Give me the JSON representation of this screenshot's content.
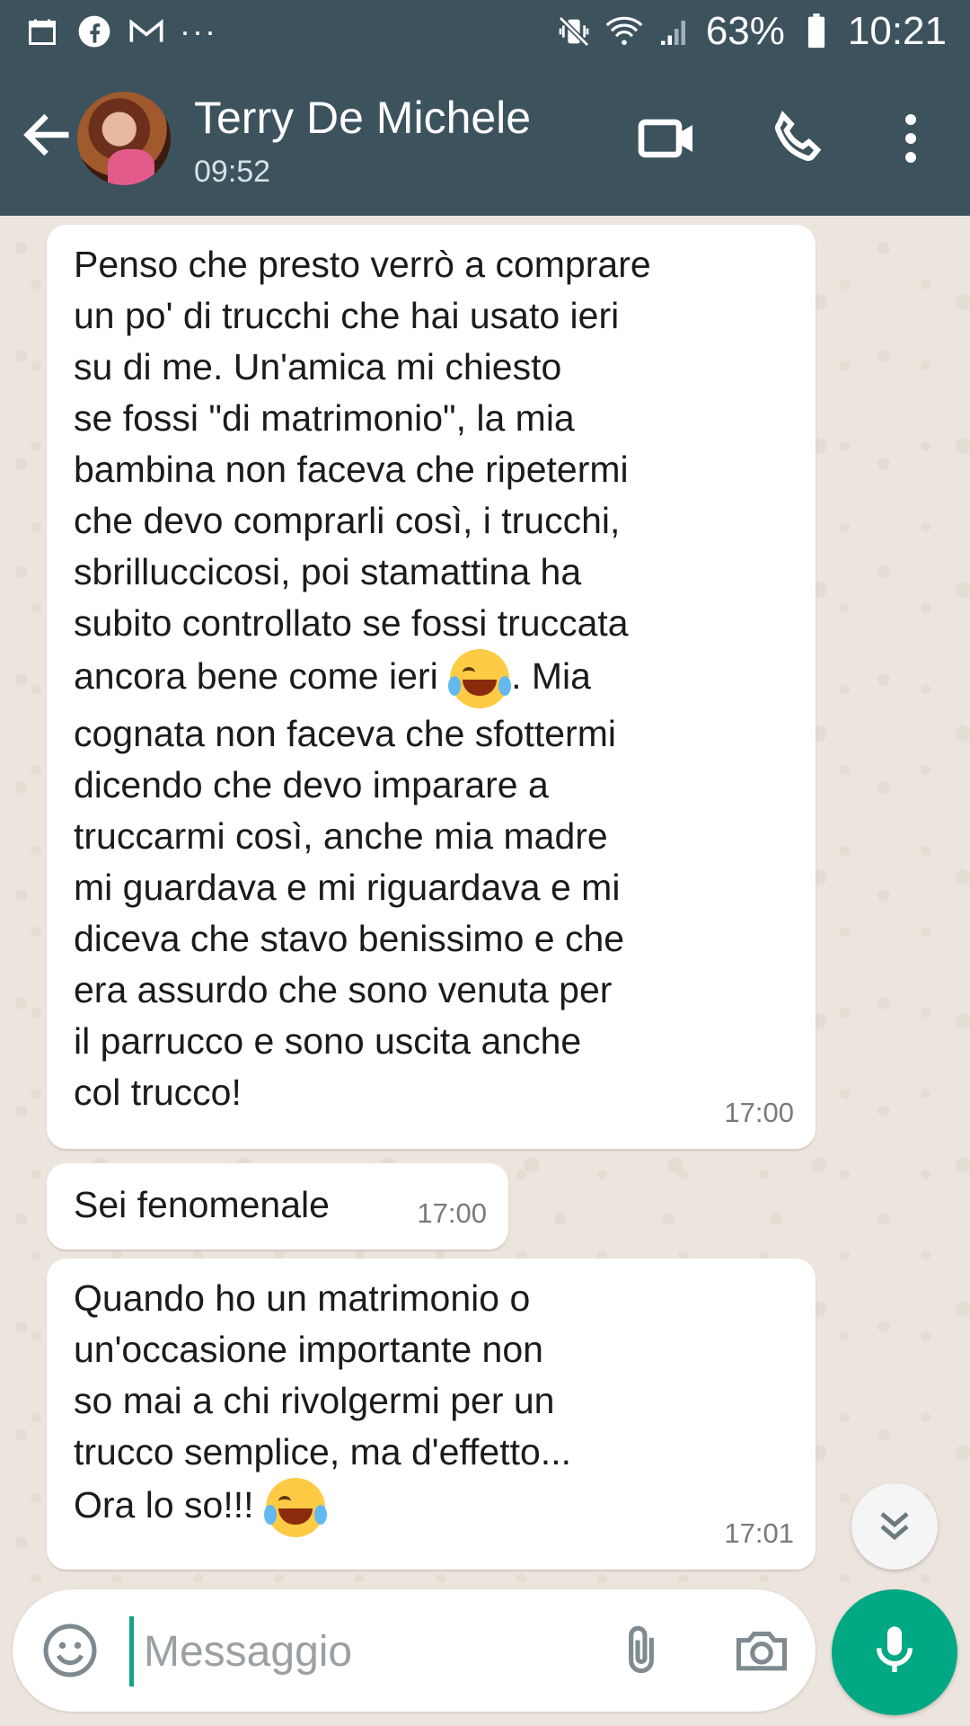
{
  "status_bar": {
    "battery": "63%",
    "time": "10:21",
    "more": "···"
  },
  "header": {
    "contact_name": "Terry De Michele",
    "last_seen": "09:52"
  },
  "messages": [
    {
      "lines_before_emoji": "Penso che presto verrò a comprare\nun po' di trucchi che hai usato ieri\nsu di me. Un'amica mi chiesto\nse fossi \"di matrimonio\", la mia\nbambina non faceva che ripetermi\nche devo comprarli così, i trucchi,\nsbrilluccicosi, poi stamattina ha\nsubito controllato se fossi truccata\nancora bene come ieri ",
      "emoji": "face-with-tears-of-joy",
      "lines_after_emoji": ". Mia\ncognata non faceva che sfottermi\ndicendo che devo imparare a\ntruccarmi così, anche mia madre\nmi guardava e mi riguardava e mi\ndiceva che stavo benissimo e che\nera assurdo che sono venuta per\nil parrucco e sono uscita anche\ncol trucco!",
      "time": "17:00"
    },
    {
      "text": "Sei fenomenale",
      "time": "17:00"
    },
    {
      "lines_before_emoji": "Quando ho un matrimonio o\nun'occasione importante non\nso mai a chi rivolgermi per un\ntrucco semplice, ma d'effetto...\nOra lo so!!! ",
      "emoji": "face-with-tears-of-joy",
      "time": "17:01"
    }
  ],
  "composer": {
    "placeholder": "Messaggio"
  },
  "colors": {
    "header": "#3c525d",
    "accent": "#00a884",
    "bubble": "#ffffff",
    "wallpaper": "#ece5dd"
  }
}
